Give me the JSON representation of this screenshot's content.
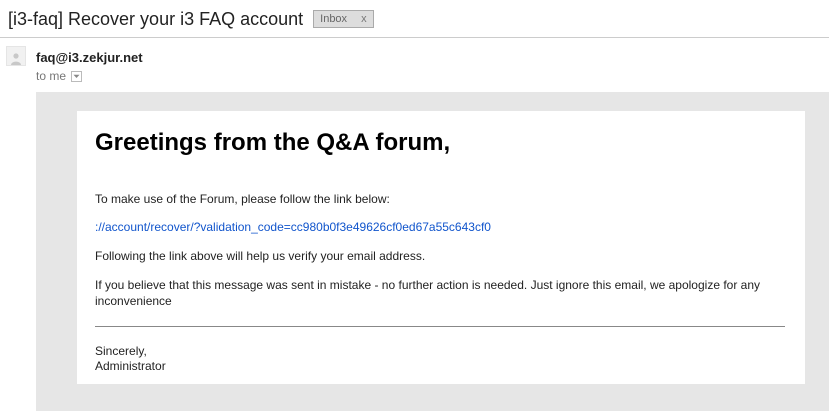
{
  "subject": "[i3-faq] Recover your i3 FAQ account",
  "label": {
    "text": "Inbox",
    "close": "x"
  },
  "sender": "faq@i3.zekjur.net",
  "recipient": "to me",
  "icons": {
    "avatar": "default-avatar-icon",
    "recipient_menu": "chevron-down-icon"
  },
  "colors": {
    "link": "#1155cc",
    "frame": "#e6e6e6"
  },
  "message": {
    "greeting": "Greetings from the Q&A forum,",
    "intro": "To make use of the Forum, please follow the link below:",
    "link": "://account/recover/?validation_code=cc980b0f3e49626cf0ed67a55c643cf0",
    "verify": "Following the link above will help us verify your email address.",
    "mistake": "If you believe that this message was sent in mistake - no further action is needed. Just ignore this email, we apologize for any inconvenience",
    "closing": "Sincerely,",
    "signature": "Administrator"
  }
}
